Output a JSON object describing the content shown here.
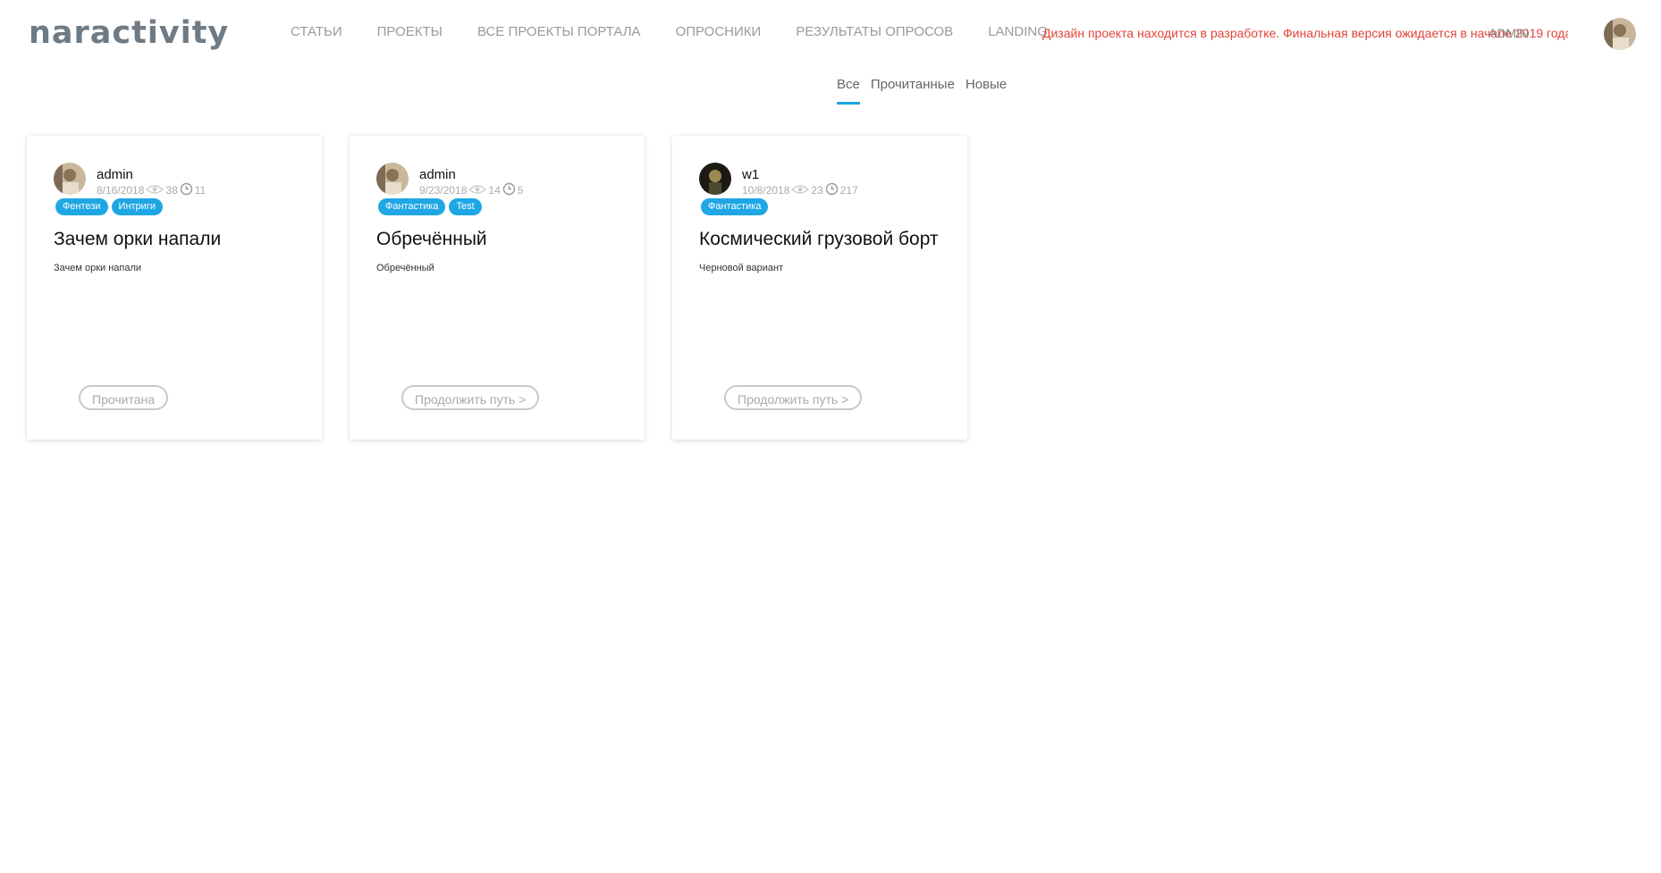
{
  "header": {
    "logo_text": "naractivity",
    "nav": [
      {
        "label": "СТАТЬИ"
      },
      {
        "label": "ПРОЕКТЫ"
      },
      {
        "label": "ВСЕ ПРОЕКТЫ ПОРТАЛА"
      },
      {
        "label": "ОПРОСНИКИ"
      },
      {
        "label": "РЕЗУЛЬТАТЫ ОПРОСОВ"
      },
      {
        "label": "LANDING"
      }
    ],
    "notice": "Дизайн проекта находится в разработке. Финальная версия ожидается в начале 2019 года",
    "user_name": "ADMIN"
  },
  "tabs": [
    {
      "label": "Все",
      "active": true
    },
    {
      "label": "Прочитанные",
      "active": false
    },
    {
      "label": "Новые",
      "active": false
    }
  ],
  "cards": [
    {
      "author": "admin",
      "date": "8/16/2018",
      "views": "38",
      "time": "11",
      "tags": [
        "Фентези",
        "Интриги"
      ],
      "title": "Зачем орки напали",
      "description": "Зачем орки напали",
      "button": "Прочитана"
    },
    {
      "author": "admin",
      "date": "9/23/2018",
      "views": "14",
      "time": "5",
      "tags": [
        "Фантастика",
        "Test"
      ],
      "title": "Обречённый",
      "description": "Обречённый",
      "button": "Продолжить путь >"
    },
    {
      "author": "w1",
      "date": "10/8/2018",
      "views": "23",
      "time": "217",
      "tags": [
        "Фантастика"
      ],
      "title": "Космический грузовой борт",
      "description": "Черновой вариант",
      "button": "Продолжить путь >"
    }
  ],
  "colors": {
    "accent": "#1ea7e4",
    "notice": "#e0453a",
    "nav_text": "#9a9a9a"
  }
}
